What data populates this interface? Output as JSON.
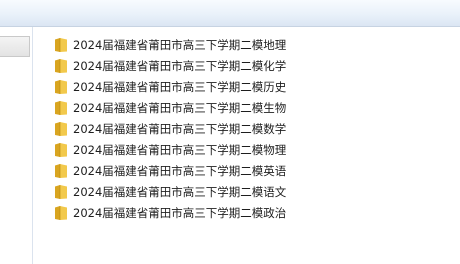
{
  "folders": [
    {
      "name": "2024届福建省莆田市高三下学期二模地理",
      "icon": "folder-icon"
    },
    {
      "name": "2024届福建省莆田市高三下学期二模化学",
      "icon": "folder-icon"
    },
    {
      "name": "2024届福建省莆田市高三下学期二模历史",
      "icon": "folder-icon"
    },
    {
      "name": "2024届福建省莆田市高三下学期二模生物",
      "icon": "folder-icon"
    },
    {
      "name": "2024届福建省莆田市高三下学期二模数学",
      "icon": "folder-icon"
    },
    {
      "name": "2024届福建省莆田市高三下学期二模物理",
      "icon": "folder-icon"
    },
    {
      "name": "2024届福建省莆田市高三下学期二模英语",
      "icon": "folder-icon"
    },
    {
      "name": "2024届福建省莆田市高三下学期二模语文",
      "icon": "folder-icon"
    },
    {
      "name": "2024届福建省莆田市高三下学期二模政治",
      "icon": "folder-icon"
    }
  ],
  "colors": {
    "folder_front": "#f2c94c",
    "folder_back": "#d9a520",
    "toolbar": "#e9f1fa"
  }
}
